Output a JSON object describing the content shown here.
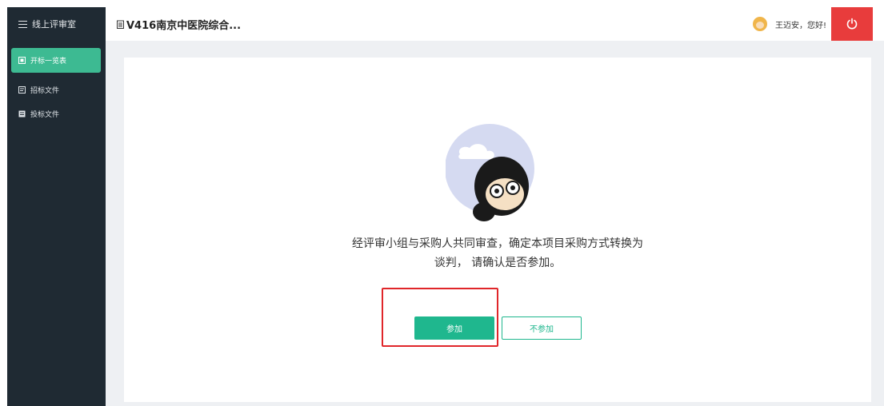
{
  "sidebar": {
    "title": "线上评审室",
    "items": [
      {
        "label": "开标一览表",
        "active": true,
        "icon": "table-icon"
      },
      {
        "label": "招标文件",
        "active": false,
        "icon": "file-icon"
      },
      {
        "label": "投标文件",
        "active": false,
        "icon": "document-icon"
      }
    ]
  },
  "header": {
    "project_title": "V416南京中医院综合...",
    "greeting": "王迈安，您好!"
  },
  "dialog": {
    "message_line1": "经评审小组与采购人共同审查，确定本项目采购方式转换为",
    "message_line2": "谈判， 请确认是否参加。",
    "join_label": "参加",
    "decline_label": "不参加"
  },
  "colors": {
    "sidebar_bg": "#1f2a33",
    "accent": "#1fb78e",
    "power": "#e83c3c",
    "highlight": "#e0262a"
  }
}
